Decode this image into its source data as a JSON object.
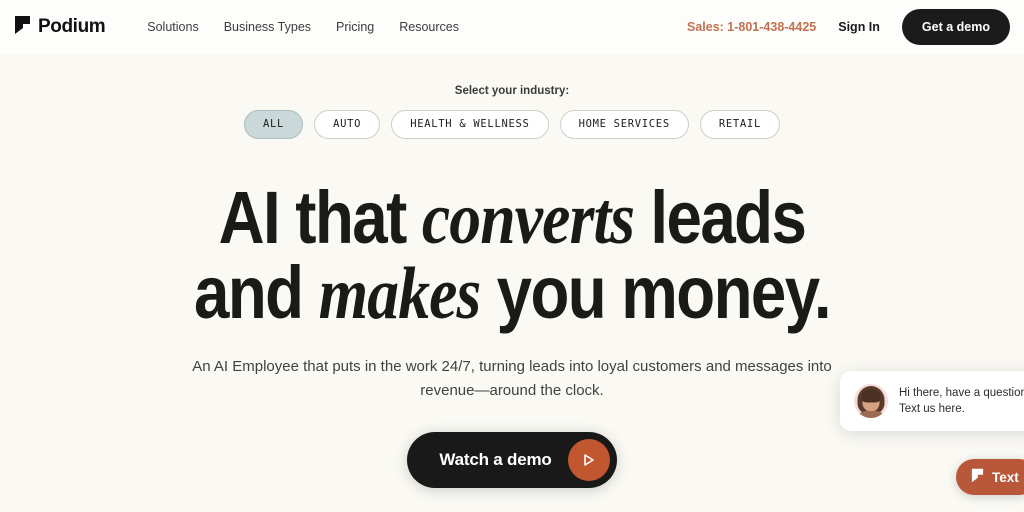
{
  "brand": {
    "name": "Podium",
    "logo_icon": "podium-flag-icon",
    "accent_rust": "#c2562f",
    "accent_sales": "#c2714f",
    "dark": "#1b1b1b",
    "page_background": "#faf9f4",
    "pill_selected_background": "#cbd8da"
  },
  "header": {
    "nav": [
      {
        "label": "Solutions"
      },
      {
        "label": "Business Types"
      },
      {
        "label": "Pricing"
      },
      {
        "label": "Resources"
      }
    ],
    "sales_label": "Sales: 1-801-438-4425",
    "signin_label": "Sign In",
    "demo_button_label": "Get a demo"
  },
  "hero": {
    "industry_label": "Select your industry:",
    "industries": [
      {
        "label": "ALL",
        "selected": true
      },
      {
        "label": "AUTO",
        "selected": false
      },
      {
        "label": "HEALTH & WELLNESS",
        "selected": false
      },
      {
        "label": "HOME SERVICES",
        "selected": false
      },
      {
        "label": "RETAIL",
        "selected": false
      }
    ],
    "headline_line1_a": "AI that ",
    "headline_line1_em": "converts",
    "headline_line1_b": " leads",
    "headline_line2_a": "and ",
    "headline_line2_em": "makes",
    "headline_line2_b": " you money.",
    "subhead": "An AI Employee that puts in the work 24/7, turning leads into loyal customers and messages into revenue—around the clock.",
    "watch_demo_label": "Watch a demo",
    "play_icon": "play-triangle-icon"
  },
  "chat_widget": {
    "message": "Hi there, have a question? Text us here.",
    "avatar_icon": "agent-avatar",
    "text_button_label": "Text",
    "text_button_icon": "podium-flag-icon"
  }
}
